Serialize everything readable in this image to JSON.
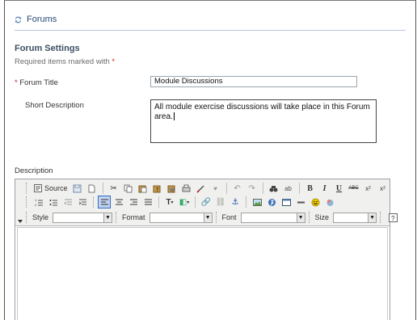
{
  "header": {
    "title": "Forums",
    "icon": "forum-icon"
  },
  "settings": {
    "title": "Forum Settings",
    "required_note": "Required items marked with",
    "required_marker": "*"
  },
  "form": {
    "forum_title_label": "Forum Title",
    "forum_title_value": "Module Discussions",
    "short_description_label": "Short Description",
    "short_description_value": "All module exercise discussions will take place in this Forum area.",
    "description_label": "Description"
  },
  "editor": {
    "source_label": "Source",
    "style_label": "Style",
    "format_label": "Format",
    "font_label": "Font",
    "size_label": "Size",
    "style_value": "",
    "format_value": "",
    "font_value": "",
    "size_value": ""
  },
  "colors": {
    "accent": "#2a4a7a",
    "required": "#cc2222",
    "toolbar_bg": "#f0f0ee"
  }
}
